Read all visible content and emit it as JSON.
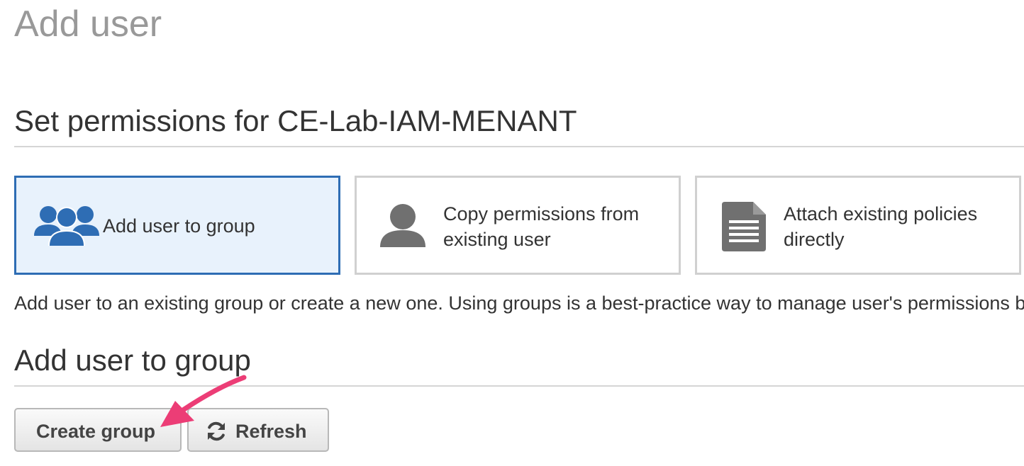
{
  "page": {
    "title": "Add user"
  },
  "permissions": {
    "title": "Set permissions for CE-Lab-IAM-MENANT",
    "options": [
      {
        "label": "Add user to group",
        "icon": "user-group-icon",
        "selected": true
      },
      {
        "label": "Copy permissions from existing user",
        "icon": "user-icon",
        "selected": false
      },
      {
        "label": "Attach existing policies directly",
        "icon": "document-icon",
        "selected": false
      }
    ],
    "description": "Add user to an existing group or create a new one. Using groups is a best-practice way to manage user's permissions by job functions."
  },
  "group_section": {
    "title": "Add user to group",
    "create_button": "Create group",
    "refresh_button": "Refresh",
    "refresh_icon": "refresh-icon"
  },
  "colors": {
    "selected_border": "#2e6db4",
    "selected_background": "#e8f2fc",
    "icon_blue": "#2e6db4",
    "icon_gray": "#707070",
    "annotation_arrow": "#ec3d76"
  }
}
